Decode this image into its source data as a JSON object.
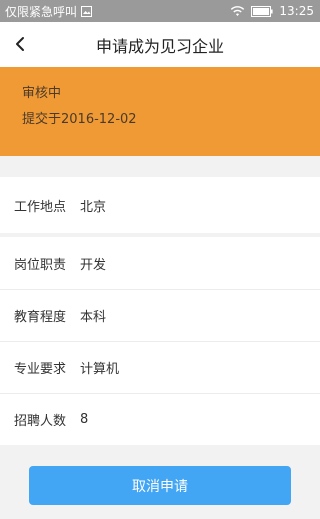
{
  "status_bar": {
    "carrier_text": "仅限紧急呼叫",
    "time": "13:25"
  },
  "header": {
    "title": "申请成为见习企业",
    "back_icon": "chevron-left-icon"
  },
  "application_status": {
    "state": "审核中",
    "submitted": "提交于2016-12-02",
    "background_color": "#f09a36"
  },
  "details": [
    {
      "label": "工作地点",
      "value": "北京"
    },
    {
      "label": "岗位职责",
      "value": "开发"
    },
    {
      "label": "教育程度",
      "value": "本科"
    },
    {
      "label": "专业要求",
      "value": "计算机"
    },
    {
      "label": "招聘人数",
      "value": "8"
    }
  ],
  "actions": {
    "cancel_label": "取消申请",
    "button_color": "#42a6f4"
  }
}
